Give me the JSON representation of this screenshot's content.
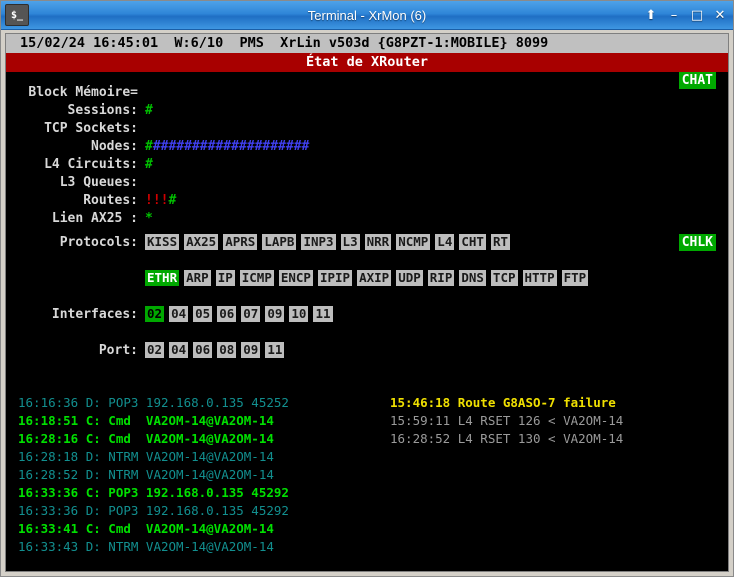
{
  "window": {
    "title": "Terminal - XrMon (6)",
    "icon_label": "$_",
    "buttons": [
      {
        "name": "shade-button",
        "glyph": "⬆"
      },
      {
        "name": "minimize-button",
        "glyph": "–"
      },
      {
        "name": "maximize-button",
        "glyph": "□"
      },
      {
        "name": "close-button",
        "glyph": "✕"
      }
    ]
  },
  "terminal": {
    "status_line": "15/02/24 16:45:01  W:6/10  PMS  XrLin v503d {G8PZT-1:MOBILE} 8099",
    "banner": "État de XRouter"
  },
  "stats": {
    "rows": [
      {
        "label": "Block Mémoire=",
        "label_plain": "Block Mémoire",
        "value": "",
        "value_color": "green"
      },
      {
        "label": "Sessions:",
        "label_plain": "Sessions",
        "value": "#",
        "value_color": "green"
      },
      {
        "label": "TCP Sockets:",
        "label_plain": "TCP Sockets",
        "value": "",
        "value_color": "green"
      },
      {
        "label": "Nodes:",
        "label_plain": "Nodes",
        "value_green": "#",
        "value_blue": "####################",
        "value_color": "mixed"
      },
      {
        "label": "L4 Circuits:",
        "label_plain": "L4 Circuits",
        "value": "#",
        "value_color": "green"
      },
      {
        "label": "L3 Queues:",
        "label_plain": "L3 Queues",
        "value": "",
        "value_color": "green"
      },
      {
        "label": "Routes:",
        "label_plain": "Routes",
        "value_red": "!!!",
        "value_green": "#",
        "value_color": "mixed"
      },
      {
        "label": "Lien AX25 :",
        "label_plain": "Lien AX25",
        "value": "*",
        "value_color": "green"
      }
    ]
  },
  "protocols": {
    "label": "Protocols:",
    "row1": [
      {
        "text": "KISS",
        "active": false
      },
      {
        "text": "AX25",
        "active": false
      },
      {
        "text": "APRS",
        "active": false
      },
      {
        "text": "LAPB",
        "active": false
      },
      {
        "text": "INP3",
        "active": false
      },
      {
        "text": "L3",
        "active": false
      },
      {
        "text": "NRR",
        "active": false
      },
      {
        "text": "NCMP",
        "active": false
      },
      {
        "text": "L4",
        "active": false
      },
      {
        "text": "CHT",
        "active": false
      },
      {
        "text": "RT",
        "active": false
      }
    ],
    "row2": [
      {
        "text": "ETHR",
        "active": true
      },
      {
        "text": "ARP",
        "active": false
      },
      {
        "text": "IP",
        "active": false
      },
      {
        "text": "ICMP",
        "active": false
      },
      {
        "text": "ENCP",
        "active": false
      },
      {
        "text": "IPIP",
        "active": false
      },
      {
        "text": "AXIP",
        "active": false
      },
      {
        "text": "UDP",
        "active": false
      },
      {
        "text": "RIP",
        "active": false
      },
      {
        "text": "DNS",
        "active": false
      },
      {
        "text": "TCP",
        "active": false
      },
      {
        "text": "HTTP",
        "active": false
      },
      {
        "text": "FTP",
        "active": false
      }
    ]
  },
  "interfaces": {
    "label": "Interfaces:",
    "items": [
      {
        "text": "02",
        "active": true
      },
      {
        "text": "04",
        "active": false
      },
      {
        "text": "05",
        "active": false
      },
      {
        "text": "06",
        "active": false
      },
      {
        "text": "07",
        "active": false
      },
      {
        "text": "09",
        "active": false
      },
      {
        "text": "10",
        "active": false
      },
      {
        "text": "11",
        "active": false
      }
    ]
  },
  "ports": {
    "label": "Port:",
    "items": [
      {
        "text": "02",
        "active": false
      },
      {
        "text": "04",
        "active": false
      },
      {
        "text": "06",
        "active": false
      },
      {
        "text": "08",
        "active": false
      },
      {
        "text": "09",
        "active": false
      },
      {
        "text": "11",
        "active": false
      }
    ]
  },
  "corner_badges": {
    "chat": "CHAT",
    "chlk": "CHLK"
  },
  "log_left": [
    {
      "text": "16:16:36 D: POP3 192.168.0.135 45252",
      "style": "d"
    },
    {
      "text": "16:18:51 C: Cmd  VA2OM-14@VA2OM-14",
      "style": "c"
    },
    {
      "text": "16:28:16 C: Cmd  VA2OM-14@VA2OM-14",
      "style": "c"
    },
    {
      "text": "16:28:18 D: NTRM VA2OM-14@VA2OM-14",
      "style": "d"
    },
    {
      "text": "16:28:52 D: NTRM VA2OM-14@VA2OM-14",
      "style": "d"
    },
    {
      "text": "16:33:36 C: POP3 192.168.0.135 45292",
      "style": "c"
    },
    {
      "text": "16:33:36 D: POP3 192.168.0.135 45292",
      "style": "d"
    },
    {
      "text": "16:33:41 C: Cmd  VA2OM-14@VA2OM-14",
      "style": "c"
    },
    {
      "text": "16:33:43 D: NTRM VA2OM-14@VA2OM-14",
      "style": "d"
    }
  ],
  "log_right": [
    {
      "text": "15:46:18 Route G8ASO-7 failure",
      "style": "y"
    },
    {
      "text": "15:59:11 L4 RSET 126 < VA2OM-14",
      "style": "gr"
    },
    {
      "text": "16:28:52 L4 RSET 130 < VA2OM-14",
      "style": "gr"
    }
  ],
  "colors": {
    "titlebar": "#2f86d8",
    "banner_bg": "#a80000",
    "status_bg": "#c0c0c0",
    "terminal_bg": "#000000",
    "accent_green": "#00a800",
    "bar_green": "#00c000",
    "bar_blue": "#4040f0",
    "bar_red": "#d00000",
    "log_teal": "#128f8f",
    "log_green": "#00e000",
    "log_yellow": "#f0e000",
    "log_grey": "#9a9a9a"
  }
}
